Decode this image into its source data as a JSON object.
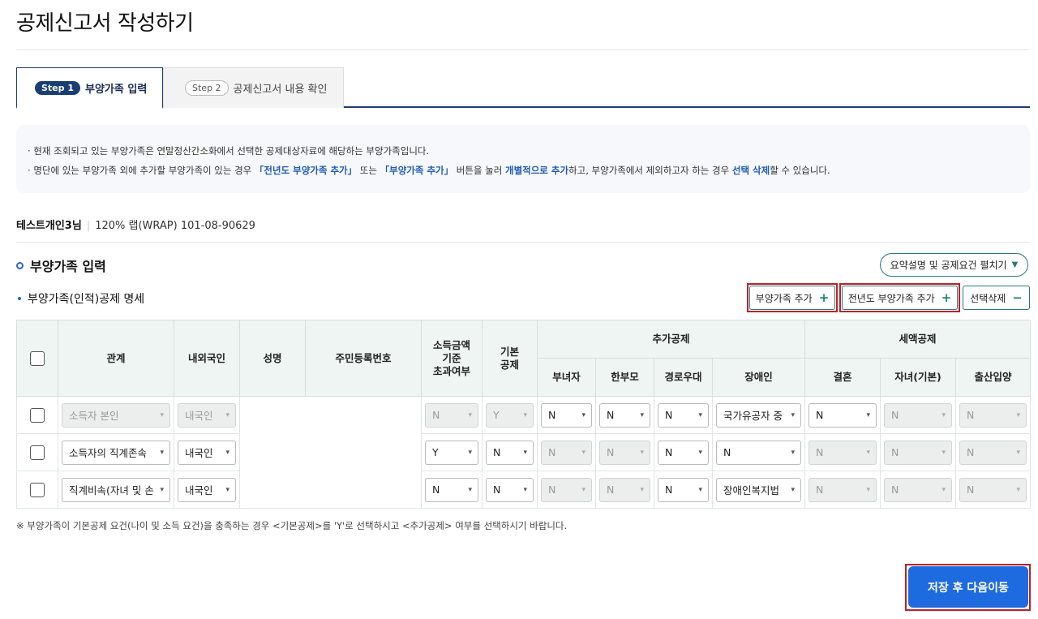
{
  "page": {
    "title": "공제신고서 작성하기"
  },
  "tabs": [
    {
      "step": "Step 1",
      "label": "부양가족 입력",
      "active": true
    },
    {
      "step": "Step 2",
      "label": "공제신고서 내용 확인",
      "active": false
    }
  ],
  "notice": {
    "line1": "현재 조회되고 있는 부양가족은 연말정산간소화에서 선택한 공제대상자료에 해당하는 부양가족입니다.",
    "line2": {
      "t1": "명단에 있는 부양가족 외에 추가할 부양가족이 있는 경우 ",
      "h1": "「전년도 부양가족 추가」",
      "t2": " 또는 ",
      "h2": "「부양가족 추가」",
      "t3": " 버튼을 눌러 ",
      "h3": "개별적으로 추가",
      "t4": "하고, 부양가족에서 제외하고자 하는 경우 ",
      "h4": "선택 삭제",
      "t5": "할 수 있습니다."
    }
  },
  "company": {
    "user": "테스트개인3님",
    "info": "120% 랩(WRAP) 101-08-90629"
  },
  "section": {
    "title": "부양가족 입력",
    "expand_label": "요약설명 및 공제요건 펼치기",
    "sub_title": "부양가족(인적)공제 명세"
  },
  "actions": {
    "add_dependent": "부양가족 추가",
    "add_prev_year": "전년도 부양가족 추가",
    "delete_selected": "선택삭제"
  },
  "table": {
    "headers": {
      "relation": "관계",
      "nationality": "내외국인",
      "name": "성명",
      "rrn": "주민등록번호",
      "income_exceed": "소득금액\n기준\n초과여부",
      "basic": "기본\n공제",
      "additional": "추가공제",
      "tax_credit": "세액공제",
      "female": "부녀자",
      "single_parent": "한부모",
      "elderly": "경로우대",
      "disabled": "장애인",
      "marriage": "결혼",
      "children": "자녀(기본)",
      "birth_adopt": "출산입양"
    },
    "rows": [
      {
        "relation": "소득자 본인",
        "nationality": "내국인",
        "income_exceed": "N",
        "basic": "Y",
        "female": "N",
        "single_parent": "N",
        "elderly": "N",
        "disabled": "국가유공자 중",
        "marriage": "N",
        "children": "N",
        "birth_adopt": "N"
      },
      {
        "relation": "소득자의 직계존속",
        "nationality": "내국인",
        "income_exceed": "Y",
        "basic": "N",
        "female": "N",
        "single_parent": "N",
        "elderly": "N",
        "disabled": "N",
        "marriage": "N",
        "children": "N",
        "birth_adopt": "N"
      },
      {
        "relation": "직계비속(자녀 및 손",
        "nationality": "내국인",
        "income_exceed": "N",
        "basic": "N",
        "female": "N",
        "single_parent": "N",
        "elderly": "N",
        "disabled": "장애인복지법",
        "marriage": "N",
        "children": "N",
        "birth_adopt": "N"
      }
    ]
  },
  "footnote": "※ 부양가족이 기본공제 요건(나이 및 소득 요건)을 충족하는 경우 <기본공제>를 'Y'로 선택하시고 <추가공제> 여부를 선택하시기 바랍니다.",
  "next_button": "저장 후 다음이동",
  "colors": {
    "primary": "#1e6be0",
    "navy": "#1a3e72",
    "teal": "#2a7a7a",
    "highlight_frame": "#b8222c"
  }
}
